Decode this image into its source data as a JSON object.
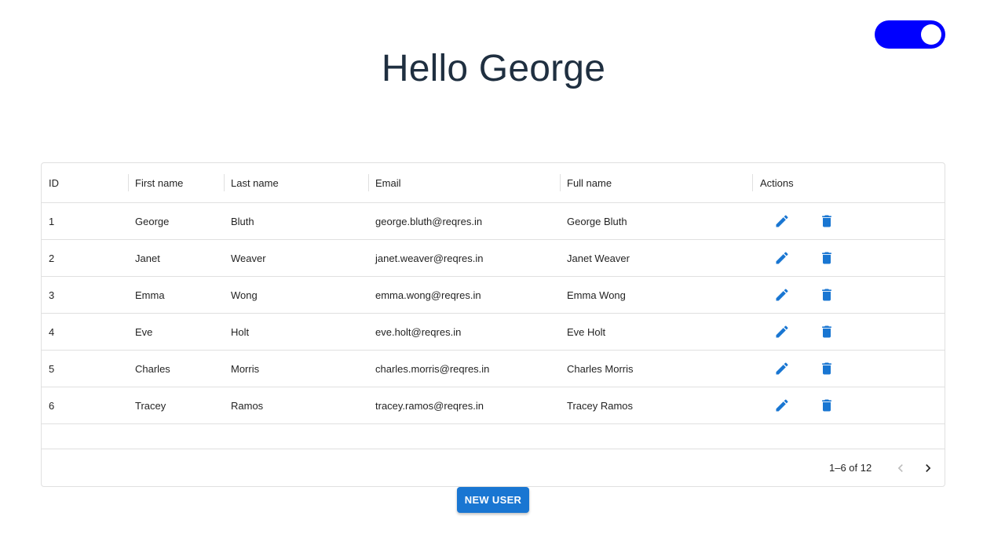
{
  "header": {
    "title": "Hello George",
    "theme_toggle_on": true
  },
  "table": {
    "columns": [
      "ID",
      "First name",
      "Last name",
      "Email",
      "Full name",
      "Actions"
    ],
    "rows": [
      {
        "id": "1",
        "first": "George",
        "last": "Bluth",
        "email": "george.bluth@reqres.in",
        "full": "George Bluth"
      },
      {
        "id": "2",
        "first": "Janet",
        "last": "Weaver",
        "email": "janet.weaver@reqres.in",
        "full": "Janet Weaver"
      },
      {
        "id": "3",
        "first": "Emma",
        "last": "Wong",
        "email": "emma.wong@reqres.in",
        "full": "Emma Wong"
      },
      {
        "id": "4",
        "first": "Eve",
        "last": "Holt",
        "email": "eve.holt@reqres.in",
        "full": "Eve Holt"
      },
      {
        "id": "5",
        "first": "Charles",
        "last": "Morris",
        "email": "charles.morris@reqres.in",
        "full": "Charles Morris"
      },
      {
        "id": "6",
        "first": "Tracey",
        "last": "Ramos",
        "email": "tracey.ramos@reqres.in",
        "full": "Tracey Ramos"
      }
    ],
    "row_actions": [
      "pencil-icon",
      "trash-icon"
    ],
    "pagination": {
      "label": "1–6 of 12",
      "prev_icon": "chevron-left-icon",
      "next_icon": "chevron-right-icon"
    }
  },
  "actions": {
    "new_user_label": "NEW USER"
  },
  "colors": {
    "toggle": "#0000ff",
    "accent": "#1976d2",
    "title": "#1f2f40"
  }
}
